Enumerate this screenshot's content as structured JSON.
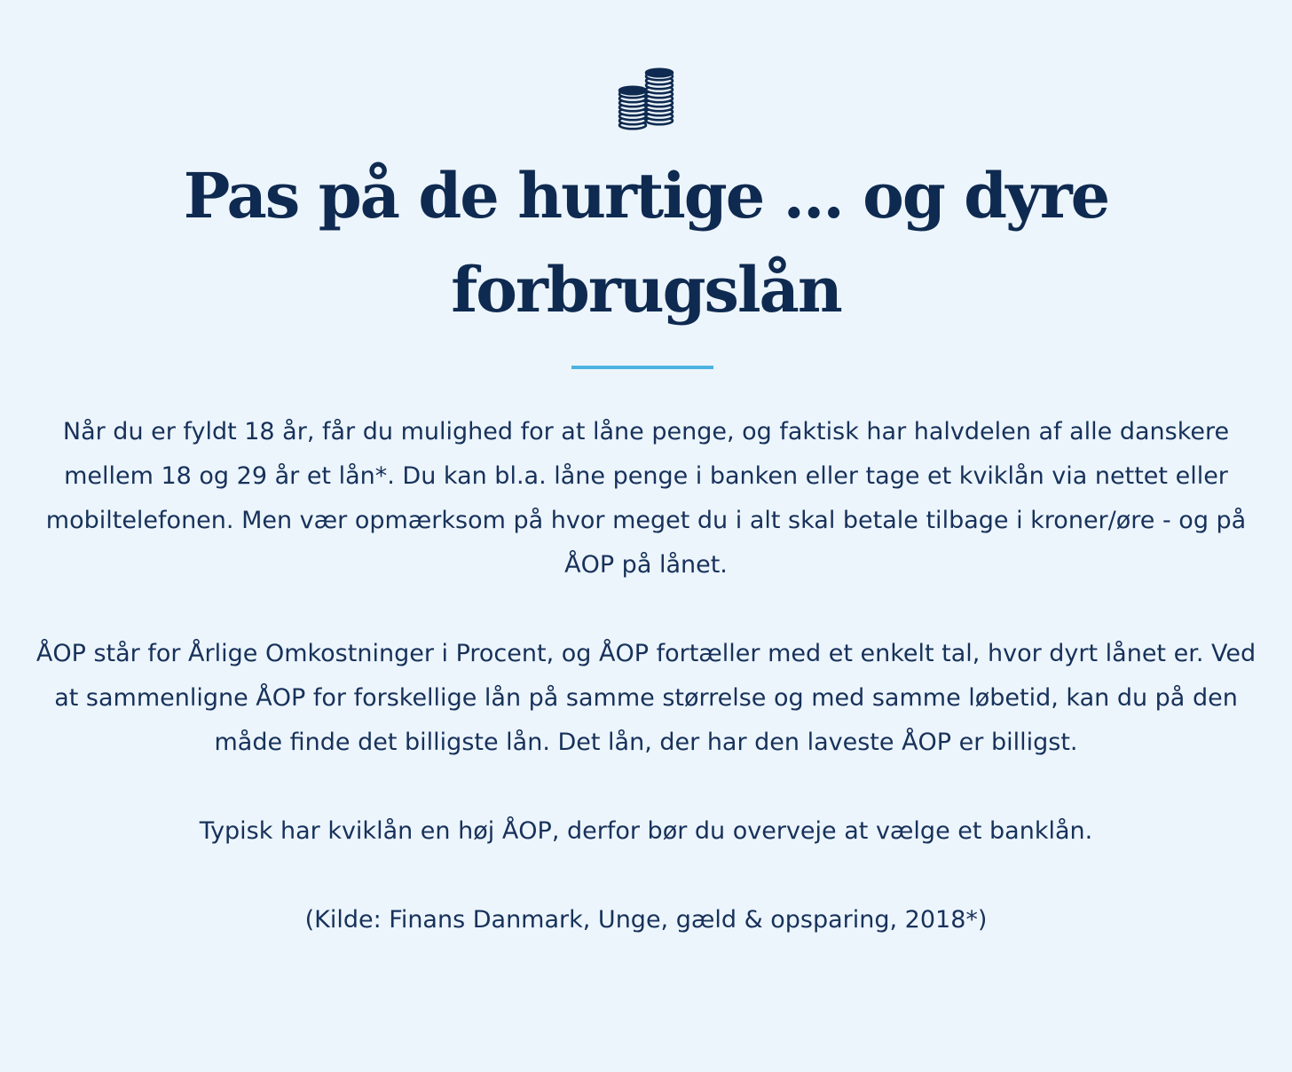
{
  "icon": "coin-stack-icon",
  "title": {
    "line1": "Pas på de hurtige ... og dyre",
    "line2": "forbrugslån"
  },
  "paragraphs": {
    "intro": "Når du er fyldt 18 år, får du mulighed for at låne penge, og faktisk har halvdelen af alle danskere mellem 18 og 29 år et lån*. Du kan bl.a. låne penge i banken eller tage et kviklån via nettet eller mobiltelefonen. Men vær opmærksom på hvor meget du i alt skal betale tilbage i kroner/øre - og på ÅOP på lånet.",
    "aop": "ÅOP står for Årlige Omkostninger i Procent, og ÅOP fortæller med et enkelt tal, hvor dyrt lånet er. Ved at sammenligne ÅOP for forskellige lån på samme størrelse og med samme løbetid, kan du på den måde finde det billigste lån. Det lån, der har den laveste ÅOP er billigst.",
    "tip": "Typisk har kviklån en høj ÅOP, derfor bør du overveje at vælge et banklån.",
    "source": "(Kilde: Finans Danmark, Unge, gæld & opsparing, 2018*)"
  },
  "colors": {
    "background": "#ecf5fc",
    "heading": "#0f2a50",
    "text": "#17315a",
    "accent": "#4cb3e0"
  }
}
